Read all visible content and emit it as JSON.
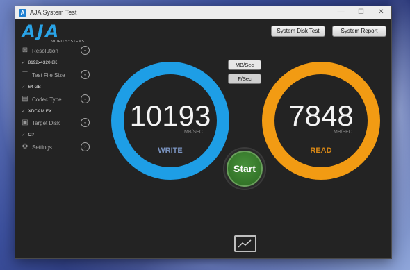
{
  "window": {
    "title": "AJA System Test",
    "minimize": "—",
    "maximize": "☐",
    "close": "✕"
  },
  "logo": {
    "text": "AJA",
    "subtitle": "VIDEO SYSTEMS"
  },
  "toolbar": {
    "system_disk_test": "System Disk Test",
    "system_report": "System Report"
  },
  "sidebar": {
    "items": [
      {
        "label": "Resolution",
        "value": "8192x4320 8K",
        "icon": "resolution-icon"
      },
      {
        "label": "Test File Size",
        "value": "64 GB",
        "icon": "file-size-icon"
      },
      {
        "label": "Codec Type",
        "value": "XDCAM EX",
        "icon": "codec-icon"
      },
      {
        "label": "Target Disk",
        "value": "C:/",
        "icon": "disk-icon"
      },
      {
        "label": "Settings",
        "icon": "settings-icon"
      }
    ],
    "tick": "✓"
  },
  "units": {
    "mb": "MB/Sec",
    "f": "F/Sec",
    "selected": "F/Sec"
  },
  "write": {
    "value": "10193",
    "unit": "MB/SEC",
    "label": "WRITE",
    "color": "#1e9ee6",
    "label_color": "#7a93bf"
  },
  "read": {
    "value": "7848",
    "unit": "MB/SEC",
    "label": "READ",
    "color": "#f29b13",
    "label_color": "#d78716"
  },
  "start": {
    "label": "Start",
    "color": "#3a7d2e"
  }
}
